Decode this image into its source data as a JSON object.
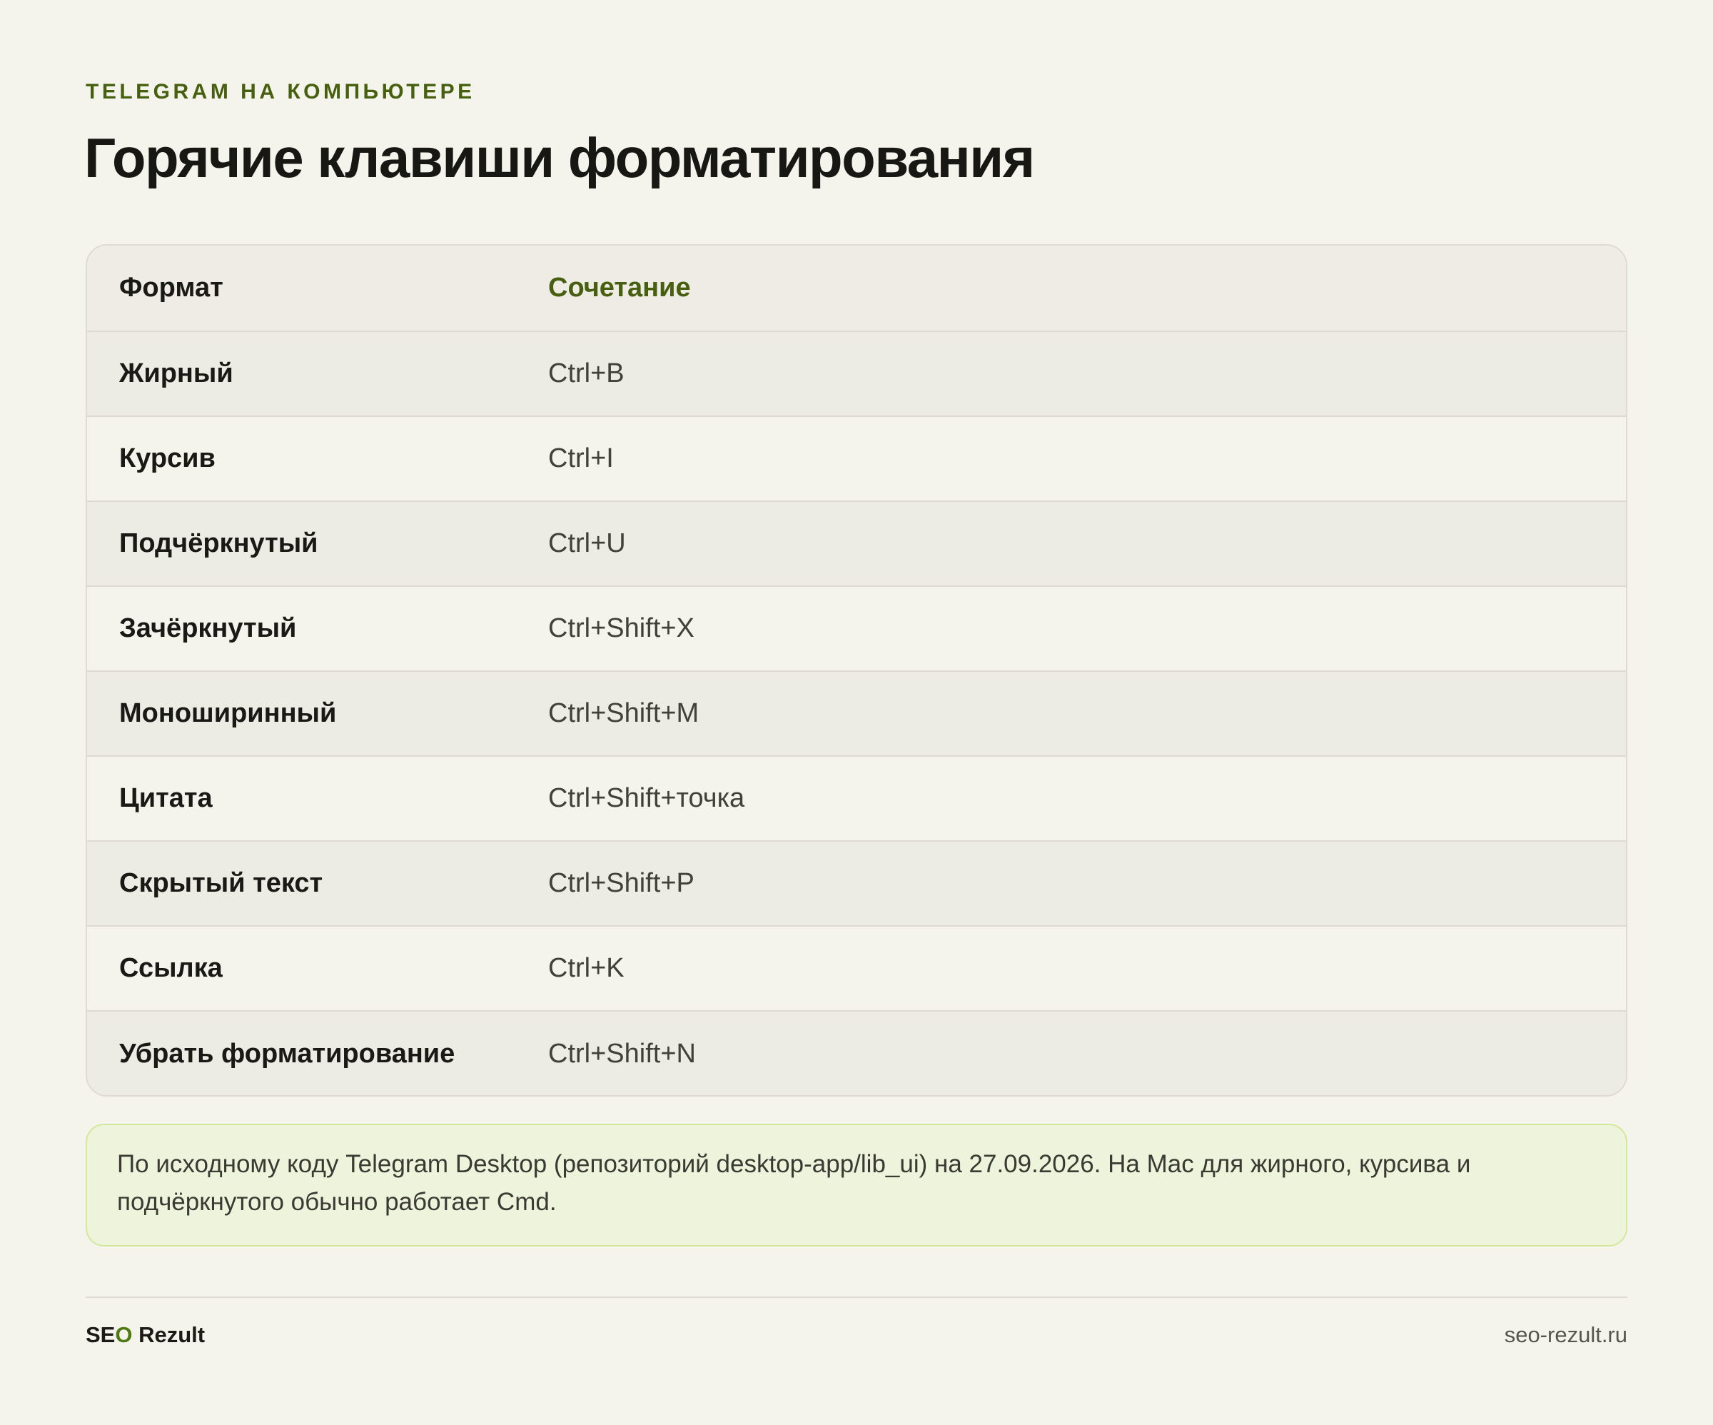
{
  "header": {
    "kicker": "TELEGRAM НА КОМПЬЮТЕРЕ",
    "title": "Горячие клавиши форматирования"
  },
  "table": {
    "columns": [
      "Формат",
      "Сочетание"
    ],
    "rows": [
      {
        "format": "Жирный",
        "combo": "Ctrl+B"
      },
      {
        "format": "Курсив",
        "combo": "Ctrl+I"
      },
      {
        "format": "Подчёркнутый",
        "combo": "Ctrl+U"
      },
      {
        "format": "Зачёркнутый",
        "combo": "Ctrl+Shift+X"
      },
      {
        "format": "Моноширинный",
        "combo": "Ctrl+Shift+M"
      },
      {
        "format": "Цитата",
        "combo": "Ctrl+Shift+точка"
      },
      {
        "format": "Скрытый текст",
        "combo": "Ctrl+Shift+P"
      },
      {
        "format": "Ссылка",
        "combo": "Ctrl+K"
      },
      {
        "format": "Убрать форматирование",
        "combo": "Ctrl+Shift+N"
      }
    ]
  },
  "note": {
    "text": "По исходному коду Telegram Desktop (репозиторий desktop-app/lib_ui) на 27.09.2026. На Mac для жирного, курсива и подчёркнутого обычно работает Cmd."
  },
  "footer": {
    "brand_prefix": "SE",
    "brand_accent": "O",
    "brand_suffix": " Rezult",
    "site": "seo-rezult.ru"
  },
  "colors": {
    "accent": "#46600f",
    "background": "#f4f3ec",
    "note_background": "#eef4dc",
    "note_border": "#d3e898"
  }
}
